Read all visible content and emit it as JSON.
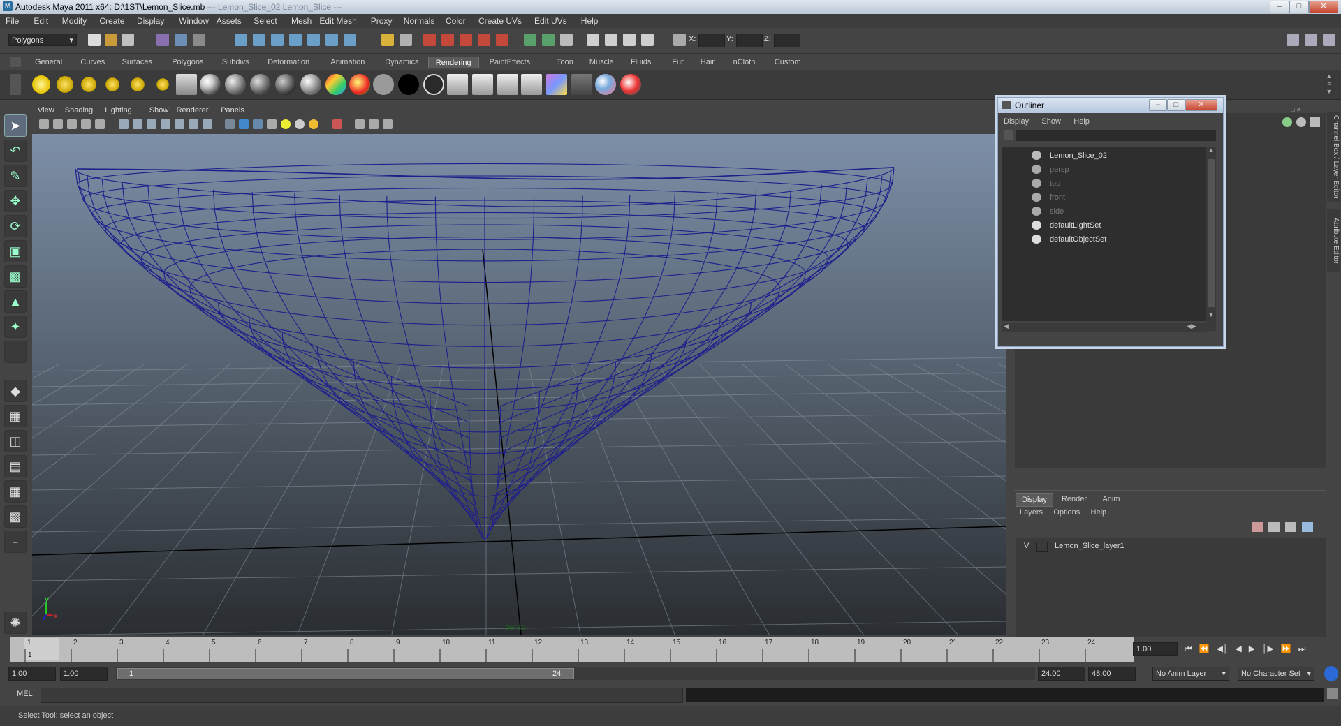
{
  "window": {
    "title": "Autodesk Maya 2011 x64: D:\\1ST\\Lemon_Slice.mb",
    "title_dim": "  --- Lemon_Slice_02 Lemon_Slice ---"
  },
  "menubar": [
    "File",
    "Edit",
    "Modify",
    "Create",
    "Display",
    "Window",
    "Assets",
    "Select",
    "Mesh",
    "Edit Mesh",
    "Proxy",
    "Normals",
    "Color",
    "Create UVs",
    "Edit UVs",
    "Help"
  ],
  "statusline": {
    "mode": "Polygons",
    "x_label": "X:",
    "y_label": "Y:",
    "z_label": "Z:"
  },
  "shelf_tabs": [
    "General",
    "Curves",
    "Surfaces",
    "Polygons",
    "Subdivs",
    "Deformation",
    "Animation",
    "Dynamics",
    "Rendering",
    "PaintEffects",
    "Toon",
    "Muscle",
    "Fluids",
    "Fur",
    "Hair",
    "nCloth",
    "Custom"
  ],
  "shelf_active": "Rendering",
  "panel_menu": [
    "View",
    "Shading",
    "Lighting",
    "Show",
    "Renderer",
    "Panels"
  ],
  "viewport": {
    "camera_label": "persp",
    "axis_y": "y",
    "axis_x": "x"
  },
  "outliner": {
    "title": "Outliner",
    "menu": [
      "Display",
      "Show",
      "Help"
    ],
    "items": [
      {
        "label": "Lemon_Slice_02",
        "dim": false,
        "icon": "mesh-icon"
      },
      {
        "label": "persp",
        "dim": true,
        "icon": "camera-icon"
      },
      {
        "label": "top",
        "dim": true,
        "icon": "camera-icon"
      },
      {
        "label": "front",
        "dim": true,
        "icon": "camera-icon"
      },
      {
        "label": "side",
        "dim": true,
        "icon": "camera-icon"
      },
      {
        "label": "defaultLightSet",
        "dim": false,
        "icon": "set-icon"
      },
      {
        "label": "defaultObjectSet",
        "dim": false,
        "icon": "set-icon"
      }
    ]
  },
  "side_tabs": [
    "Channel Box / Layer Editor",
    "Attribute Editor"
  ],
  "layer_editor": {
    "tabs": [
      "Display",
      "Render",
      "Anim"
    ],
    "menu": [
      "Layers",
      "Options",
      "Help"
    ],
    "layer_visibility": "V",
    "layer_name": "Lemon_Slice_layer1"
  },
  "timeslider": {
    "ticks": [
      "1",
      "2",
      "3",
      "4",
      "5",
      "6",
      "7",
      "8",
      "9",
      "10",
      "11",
      "12",
      "13",
      "14",
      "15",
      "16",
      "17",
      "18",
      "19",
      "20",
      "21",
      "22",
      "23",
      "24"
    ],
    "current_frame_marker": "1",
    "current_time": "1.00"
  },
  "range": {
    "start": "1.00",
    "start2": "1.00",
    "range_start": "1",
    "range_end": "24",
    "end": "24.00",
    "end2": "48.00",
    "anim_layer": "No Anim Layer",
    "char_set": "No Character Set"
  },
  "cmdline": {
    "label": "MEL"
  },
  "helpline": {
    "text": "Select Tool: select an object"
  },
  "colors": {
    "wire": "#1f1f8c",
    "viewport_top": "#7d8fa8",
    "viewport_bottom": "#2a2d31"
  }
}
